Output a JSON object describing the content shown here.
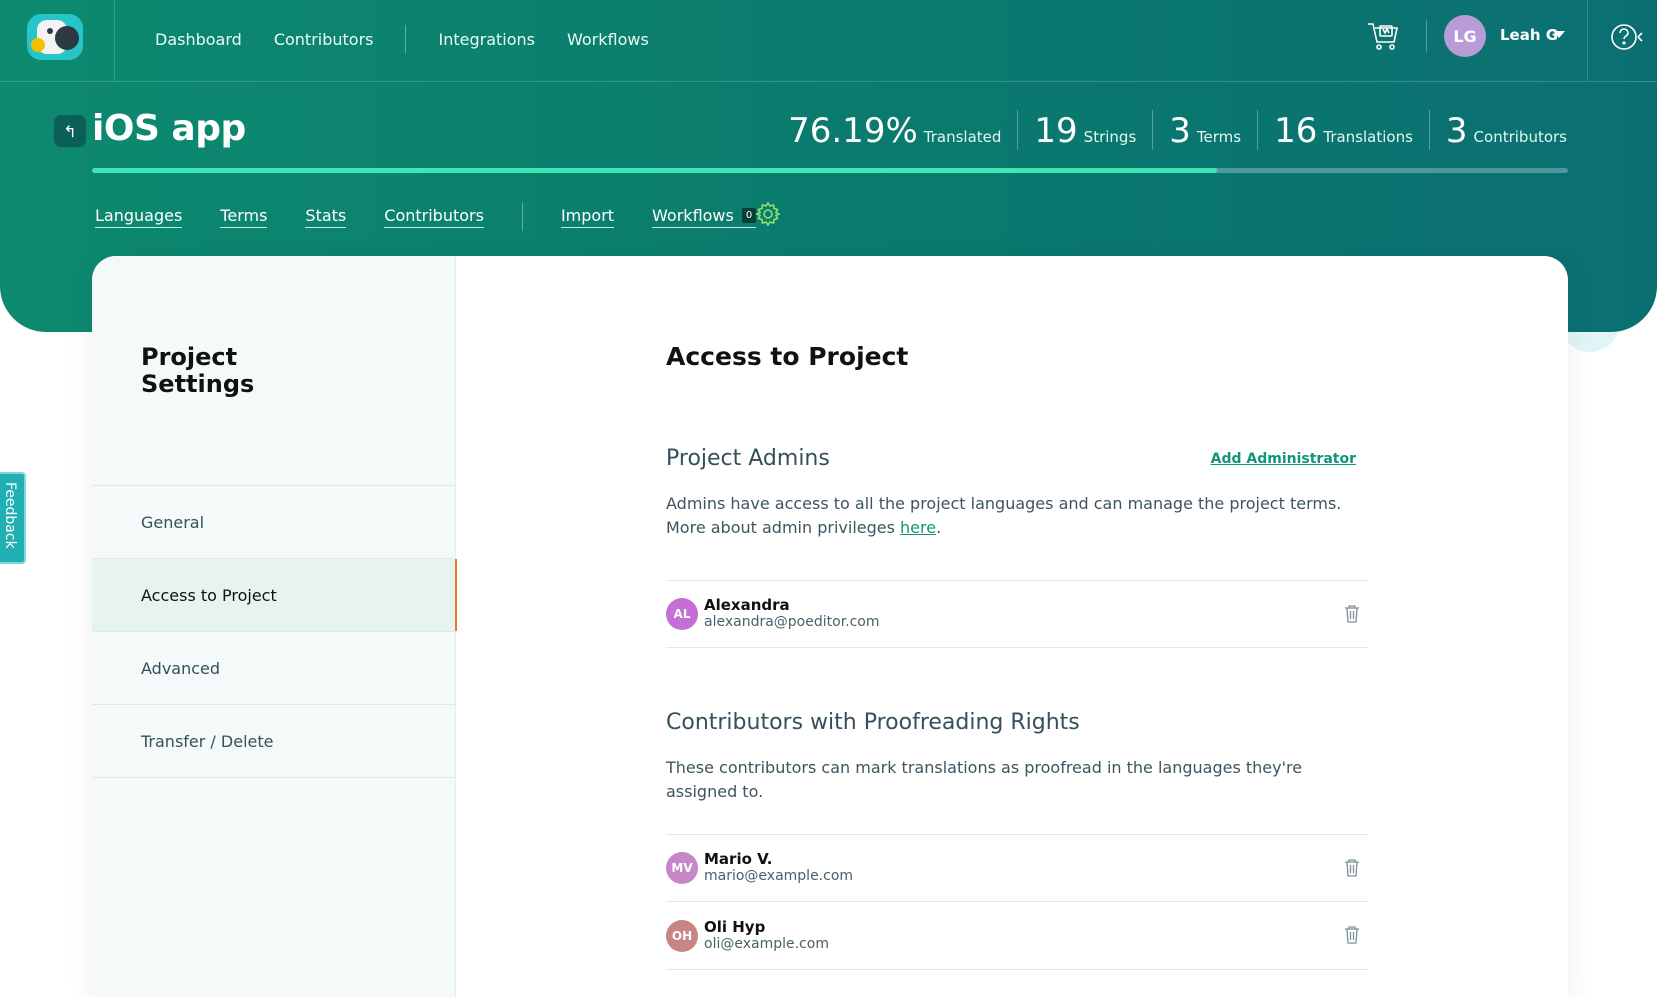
{
  "nav": {
    "links": [
      "Dashboard",
      "Contributors",
      "Integrations",
      "Workflows"
    ],
    "user": {
      "initials": "LG",
      "name": "Leah G"
    }
  },
  "project": {
    "title": "iOS app",
    "back_label": "↰",
    "stats": [
      {
        "value": "76.19%",
        "label": "Translated"
      },
      {
        "value": "19",
        "label": "Strings"
      },
      {
        "value": "3",
        "label": "Terms"
      },
      {
        "value": "16",
        "label": "Translations"
      },
      {
        "value": "3",
        "label": "Contributors"
      }
    ],
    "progress_percent": 76.19,
    "subnav": [
      "Languages",
      "Terms",
      "Stats",
      "Contributors",
      "Import",
      "Workflows"
    ],
    "workflows_badge": "0"
  },
  "sidebar": {
    "title": "Project Settings",
    "items": [
      "General",
      "Access to Project",
      "Advanced",
      "Transfer / Delete"
    ],
    "active_index": 1
  },
  "content": {
    "heading": "Access to Project",
    "admins": {
      "title": "Project Admins",
      "add_label": "Add Administrator",
      "desc_text": "Admins have access to all the project languages and can manage the project terms. More about admin privileges ",
      "desc_link": "here",
      "desc_end": ".",
      "users": [
        {
          "initials": "AL",
          "name": "Alexandra",
          "email": "alexandra@poeditor.com",
          "color": "#c56fd6"
        }
      ]
    },
    "proofreaders": {
      "title": "Contributors with Proofreading Rights",
      "desc": "These contributors can mark translations as proofread in the languages they're assigned to.",
      "users": [
        {
          "initials": "MV",
          "name": "Mario V.",
          "email": "mario@example.com",
          "color": "#c786c8"
        },
        {
          "initials": "OH",
          "name": "Oli Hyp",
          "email": "oli@example.com",
          "color": "#c78586"
        }
      ]
    }
  },
  "feedback_label": "Feedback",
  "colors": {
    "accent": "#10967a",
    "active_marker": "#e8772a",
    "progress": "#3ee6b5"
  }
}
